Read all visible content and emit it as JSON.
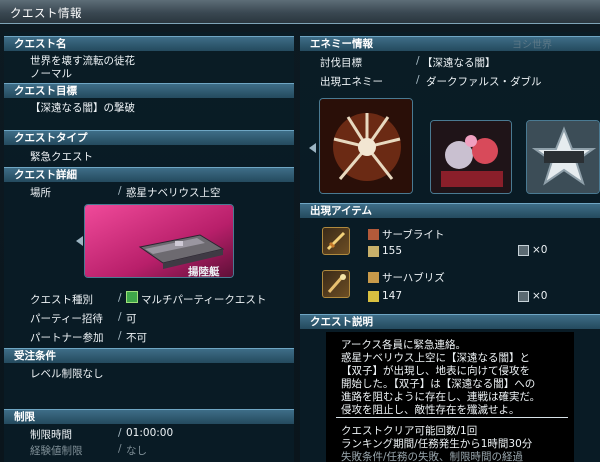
{
  "window": {
    "title": "クエスト情報"
  },
  "left": {
    "quest_name": {
      "header": "クエスト名",
      "lines": [
        "世界を壊す流転の徒花",
        "ノーマル"
      ]
    },
    "quest_goal": {
      "header": "クエスト目標",
      "text": "【深遠なる闇】の撃破"
    },
    "quest_type": {
      "header": "クエストタイプ",
      "text": "緊急クエスト"
    },
    "quest_detail": {
      "header": "クエスト詳細",
      "location_label": "場所",
      "location_value": "惑星ナベリウス上空",
      "image_caption": "揚陸艇",
      "rows": [
        {
          "label": "クエスト種別",
          "value": "マルチパーティークエスト"
        },
        {
          "label": "パーティー招待",
          "value": "可"
        },
        {
          "label": "パートナー参加",
          "value": "不可"
        }
      ]
    },
    "conditions": {
      "header": "受注条件",
      "text": "レベル制限なし"
    },
    "limits": {
      "header": "制限",
      "rows": [
        {
          "label": "制限時間",
          "value": "01:00:00"
        },
        {
          "label": "経験値制限",
          "value": "なし"
        }
      ]
    }
  },
  "right": {
    "enemy_info": {
      "header": "エネミー情報",
      "target_label": "討伐目標",
      "target_value": "【深遠なる闇】",
      "appear_label": "出現エネミー",
      "appear_value": "ダークファルス・ダブル",
      "watermark": "ヨシ世界"
    },
    "items": {
      "header": "出現アイテム",
      "list": [
        {
          "name": "サーブライト",
          "value": "155",
          "count": "×0",
          "icon": "sword-icon"
        },
        {
          "name": "サーハブリズ",
          "value": "147",
          "count": "×0",
          "icon": "staff-icon"
        }
      ]
    },
    "description": {
      "header": "クエスト説明",
      "lines": [
        "アークス各員に緊急連絡。",
        "惑星ナベリウス上空に【深遠なる闇】と",
        "【双子】が出現し、地表に向けて侵攻を",
        "開始した。【双子】は【深遠なる闇】への",
        "進路を阻むように存在し、連戦は確実だ。",
        "侵攻を阻止し、敵性存在を殲滅せよ。"
      ],
      "footer_lines": [
        "クエストクリア可能回数/1回",
        "ランキング期間/任務発生から1時間30分",
        "失敗条件/任務の失敗、制限時間の経過"
      ]
    }
  },
  "colors": {
    "header_blue": "#2f5a72",
    "accent": "#6fa6c4",
    "pink_area": "#d8307a"
  }
}
